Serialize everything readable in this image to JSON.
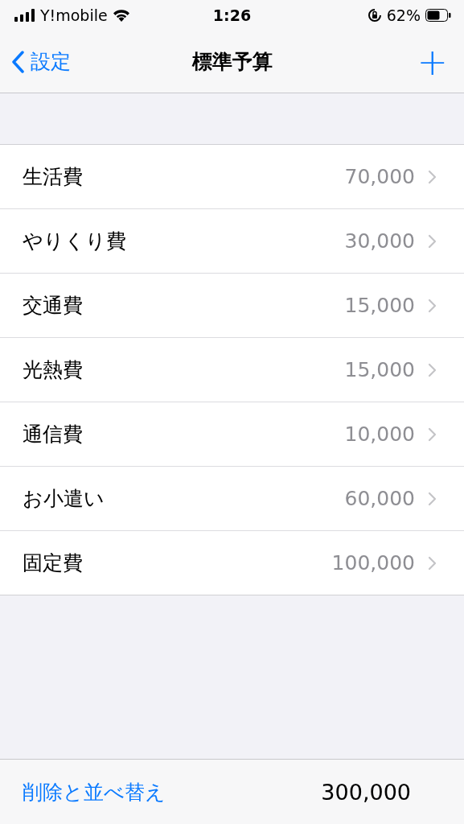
{
  "status_bar": {
    "carrier": "Y!mobile",
    "time": "1:26",
    "battery": "62%"
  },
  "nav": {
    "back": "設定",
    "title": "標準予算",
    "add": "+"
  },
  "rows": [
    {
      "label": "生活費",
      "value": "70,000"
    },
    {
      "label": "やりくり費",
      "value": "30,000"
    },
    {
      "label": "交通費",
      "value": "15,000"
    },
    {
      "label": "光熱費",
      "value": "15,000"
    },
    {
      "label": "通信費",
      "value": "10,000"
    },
    {
      "label": "お小遣い",
      "value": "60,000"
    },
    {
      "label": "固定費",
      "value": "100,000"
    }
  ],
  "toolbar": {
    "action": "削除と並べ替え",
    "total": "300,000"
  }
}
